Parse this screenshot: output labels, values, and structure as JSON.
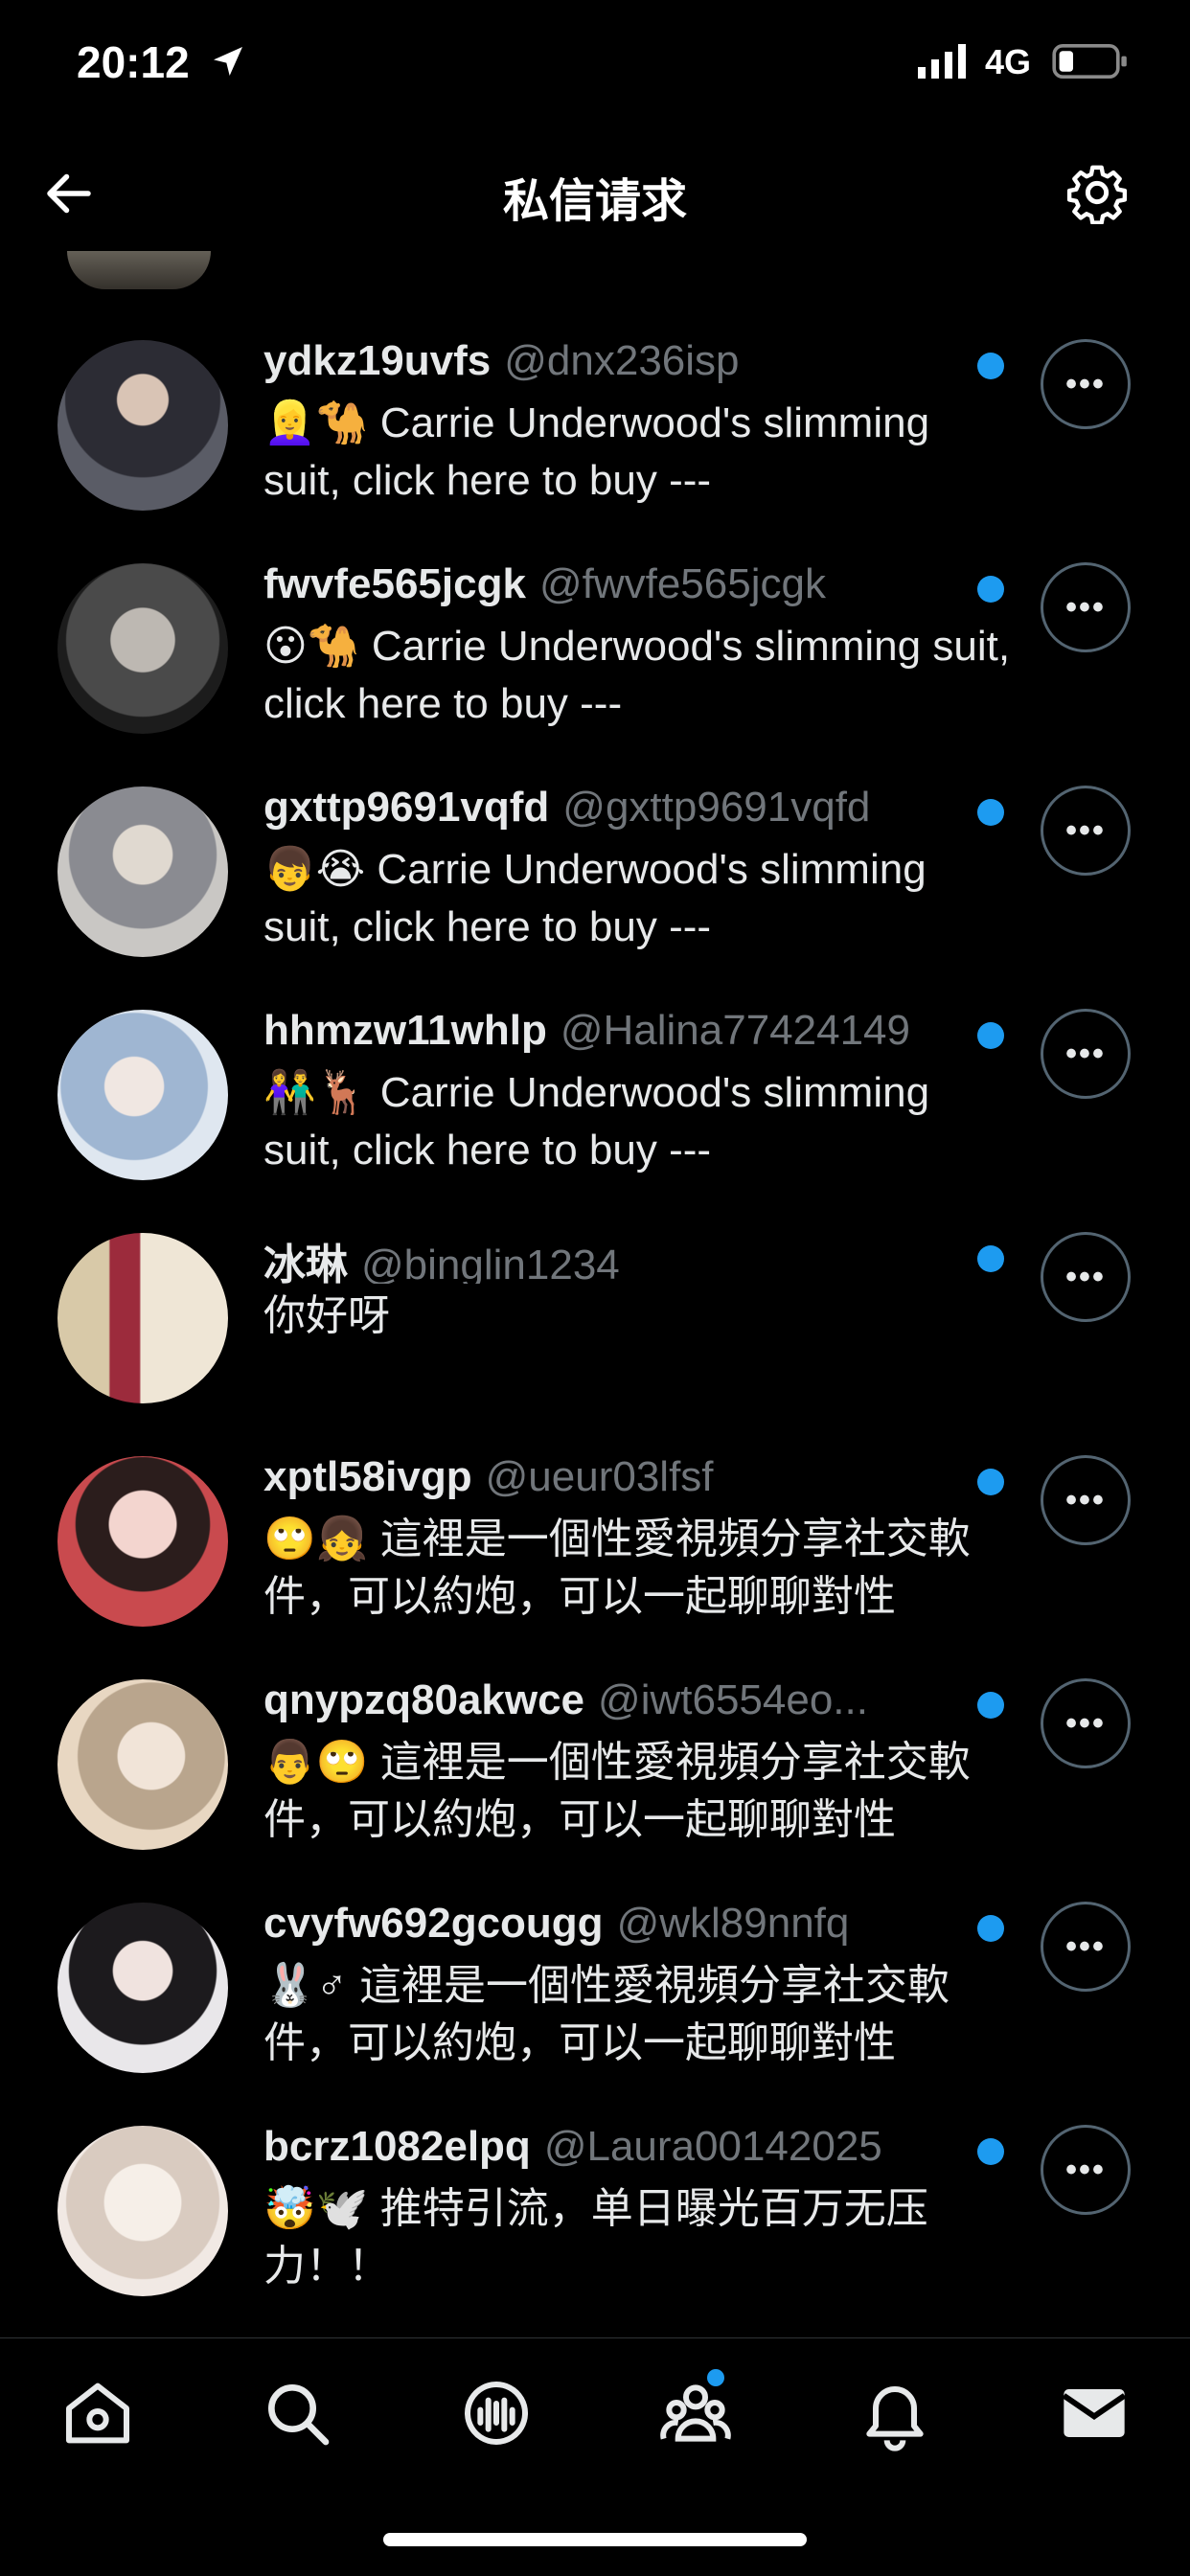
{
  "status_bar": {
    "time": "20:12",
    "network": "4G",
    "icons": [
      "location-arrow-icon",
      "signal-bars-icon",
      "battery-icon"
    ]
  },
  "header": {
    "title": "私信请求",
    "back_icon": "arrow-left-icon",
    "settings_icon": "gear-icon"
  },
  "colors": {
    "background": "#000000",
    "text": "#e7e9ea",
    "muted": "#71767b",
    "accent": "#1d9bf0"
  },
  "requests": [
    {
      "name": "ydkz19uvfs",
      "handle": "@dnx236isp",
      "preview": "👱‍♀️🐪 Carrie Underwood's slimming suit, click here to buy ---",
      "unread": true
    },
    {
      "name": "fwvfe565jcgk",
      "handle": "@fwvfe565jcgk",
      "preview": "😮🐪 Carrie Underwood's slimming suit, click here to buy ---",
      "unread": true
    },
    {
      "name": "gxttp9691vqfd",
      "handle": "@gxttp9691vqfd",
      "preview": "👦😭 Carrie Underwood's slimming suit, click here to buy ---",
      "unread": true
    },
    {
      "name": "hhmzw11whlp",
      "handle": "@Halina77424149",
      "preview": "👫🦌 Carrie Underwood's slimming suit, click here to buy ---",
      "unread": true
    },
    {
      "name": "冰琳",
      "handle": "@binglin1234",
      "preview": "你好呀",
      "unread": true
    },
    {
      "name": "xptl58ivgp",
      "handle": "@ueur03lfsf",
      "preview": "🙄👧 這裡是一個性愛視頻分享社交軟件，可以約炮，可以一起聊聊對性",
      "unread": true
    },
    {
      "name": "qnypzq80akwce",
      "handle": "@iwt6554eo...",
      "preview": "👨🙄 這裡是一個性愛視頻分享社交軟件，可以約炮，可以一起聊聊對性",
      "unread": true
    },
    {
      "name": "cvyfw692gcougg",
      "handle": "@wkl89nnfq",
      "preview": "🐰♂ 這裡是一個性愛視頻分享社交軟件，可以約炮，可以一起聊聊對性",
      "unread": true
    },
    {
      "name": "bcrz1082elpq",
      "handle": "@Laura00142025",
      "preview": "🤯🕊️ 推特引流，单日曝光百万无压力！！",
      "unread": true
    }
  ],
  "more_label": "•••",
  "bottom_nav": [
    {
      "icon": "home-icon"
    },
    {
      "icon": "search-icon"
    },
    {
      "icon": "spaces-mic-icon"
    },
    {
      "icon": "communities-icon",
      "has_badge": true
    },
    {
      "icon": "bell-icon"
    },
    {
      "icon": "mail-icon",
      "active": true
    }
  ]
}
